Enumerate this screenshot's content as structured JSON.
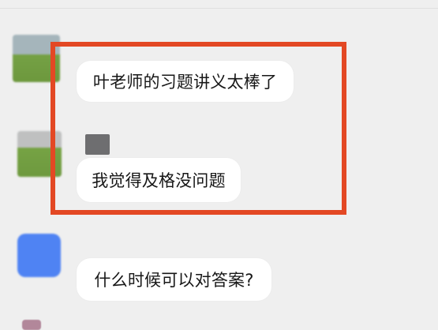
{
  "messages": [
    {
      "text": "叶老师的习题讲义太棒了"
    },
    {
      "text": "我觉得及格没问题"
    },
    {
      "text": "什么时候可以对答案?"
    }
  ],
  "colors": {
    "highlight": "#e34824",
    "bubble": "#ffffff",
    "background": "#efefef"
  }
}
